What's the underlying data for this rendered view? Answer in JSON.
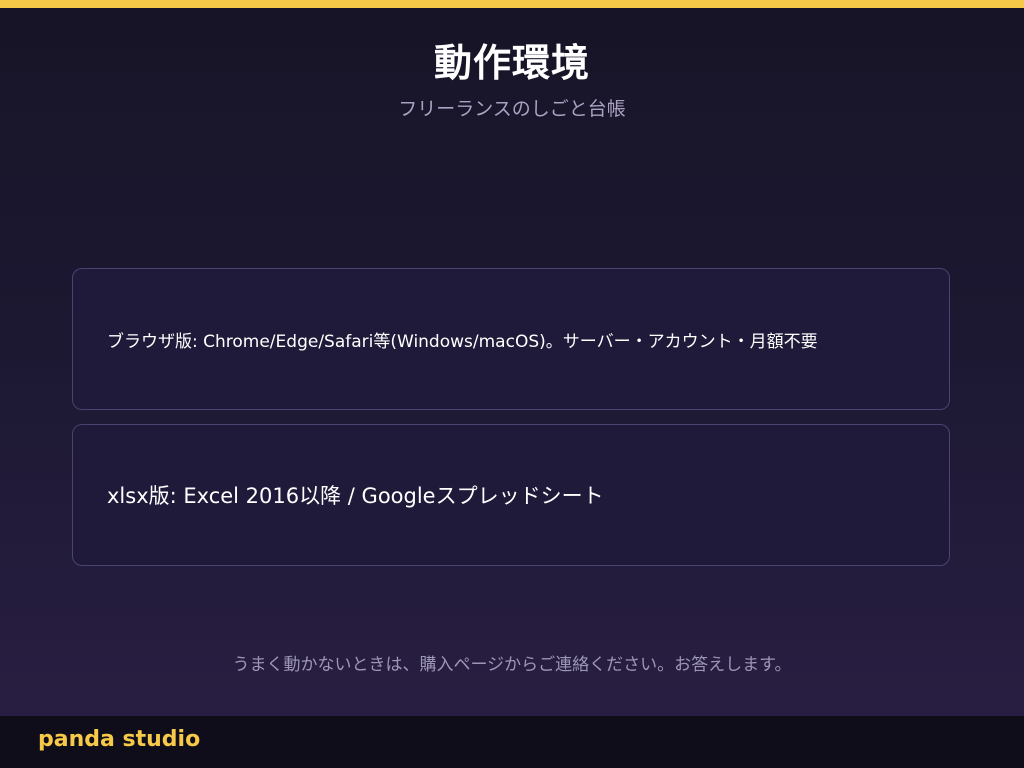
{
  "colors": {
    "accent": "#f7c948",
    "background_top": "#181427",
    "background_bottom": "#2a1f44",
    "card_background": "#1f1a39",
    "card_border": "#4b4370",
    "muted_text": "#a9a2c2",
    "footer_background": "#100d1a"
  },
  "header": {
    "title": "動作環境",
    "subtitle": "フリーランスのしごと台帳"
  },
  "requirements": [
    {
      "text": "ブラウザ版: Chrome/Edge/Safari等(Windows/macOS)。サーバー・アカウント・月額不要"
    },
    {
      "text": "xlsx版: Excel 2016以降 / Googleスプレッドシート"
    }
  ],
  "footer": {
    "note": "うまく動かないときは、購入ページからご連絡ください。お答えします。",
    "brand": "panda studio"
  }
}
